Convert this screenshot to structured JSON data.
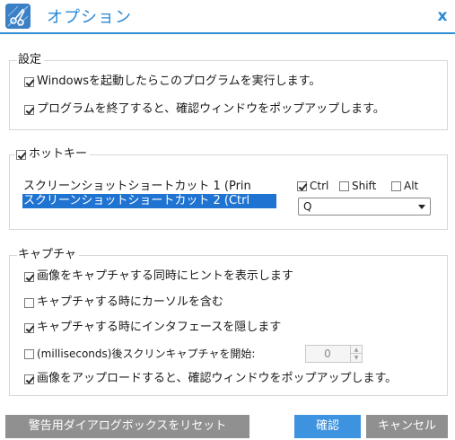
{
  "window": {
    "title": "オプション",
    "close_label": "x"
  },
  "settings": {
    "title": "設定",
    "items": [
      {
        "label": "Windowsを起動したらこのプログラムを実行します。",
        "checked": true
      },
      {
        "label": "プログラムを終了すると、確認ウィンドウをポップアップします。",
        "checked": true
      }
    ]
  },
  "hotkey": {
    "title": "ホットキー",
    "enabled": true,
    "list": [
      {
        "label": "スクリーンショットショートカット 1 (Prin",
        "selected": false
      },
      {
        "label": "スクリーンショットショートカット 2 (Ctrl",
        "selected": true
      }
    ],
    "modifiers": {
      "ctrl": {
        "label": "Ctrl",
        "checked": true
      },
      "shift": {
        "label": "Shift",
        "checked": false
      },
      "alt": {
        "label": "Alt",
        "checked": false
      }
    },
    "key": {
      "value": "Q"
    }
  },
  "capture": {
    "title": "キャプチャ",
    "items": [
      {
        "label": "画像をキャプチャする同時にヒントを表示します",
        "checked": true
      },
      {
        "label": "キャプチャする時にカーソルを含む",
        "checked": false
      },
      {
        "label": "キャプチャする時にインタフェースを隠します",
        "checked": true
      },
      {
        "label": "(milliseconds)後スクリンキャプチャを開始:",
        "checked": false
      },
      {
        "label": "画像をアップロードすると、確認ウィンドウをポップアップします。",
        "checked": true
      }
    ],
    "delay": {
      "value": "0"
    }
  },
  "buttons": {
    "reset": "警告用ダイアログボックスをリセット",
    "ok": "確認",
    "cancel": "キャンセル"
  },
  "colors": {
    "accent": "#2b89d4",
    "selection": "#1f73d1",
    "primary_button": "#3d93df",
    "secondary_button": "#909090"
  }
}
